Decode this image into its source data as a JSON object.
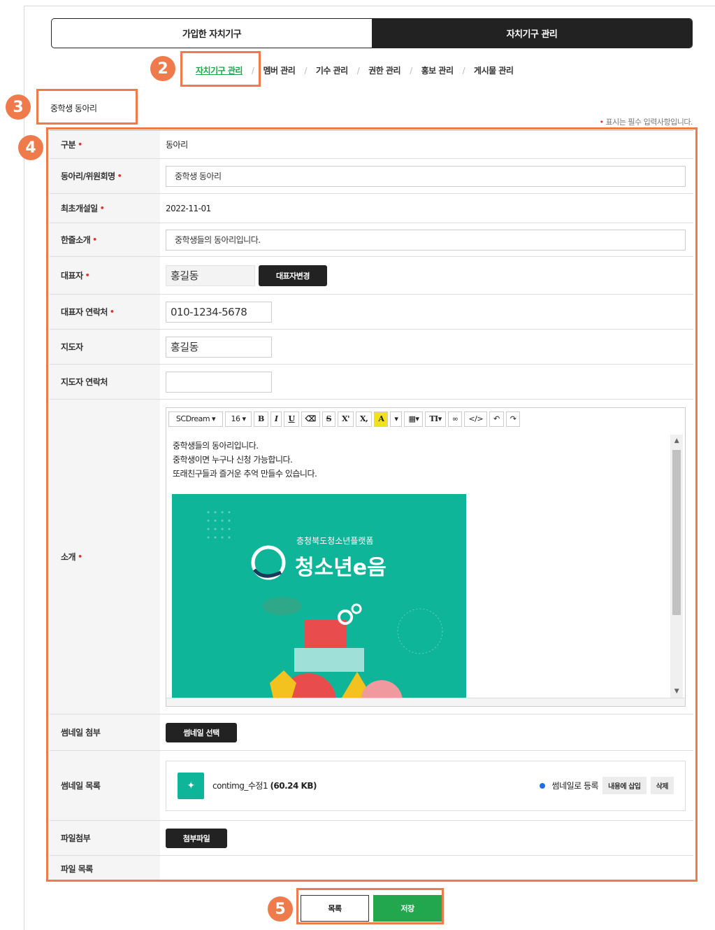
{
  "top_tabs": {
    "joined": "가입한 자치기구",
    "manage": "자치기구 관리"
  },
  "sub_tabs": [
    "자치기구 관리",
    "멤버 관리",
    "기수 관리",
    "권한 관리",
    "홍보 관리",
    "게시물 관리"
  ],
  "org_name": "중학생 동아리",
  "required_note": "표시는 필수 입력사항입니다.",
  "required_mark": "•",
  "fields": {
    "type": {
      "label": "구분",
      "value": "동아리"
    },
    "club_name": {
      "label": "동아리/위원회명",
      "value": "중학생 동아리"
    },
    "founded": {
      "label": "최초개설일",
      "value": "2022-11-01"
    },
    "intro_short": {
      "label": "한줄소개",
      "value": "중학생들의 동아리입니다."
    },
    "rep": {
      "label": "대표자",
      "value": "홍길동",
      "button": "대표자변경"
    },
    "rep_contact": {
      "label": "대표자 연락처",
      "value": "010-1234-5678"
    },
    "advisor": {
      "label": "지도자",
      "value": "홍길동"
    },
    "advisor_contact": {
      "label": "지도자 연락처",
      "value": ""
    },
    "intro": {
      "label": "소개"
    },
    "thumb_attach": {
      "label": "썸네일 첨부",
      "button": "썸네일 선택"
    },
    "thumb_list": {
      "label": "썸네일 목록"
    },
    "file_attach": {
      "label": "파일첨부",
      "button": "첨부파일"
    },
    "file_list": {
      "label": "파일 목록"
    }
  },
  "editor": {
    "font": "SCDream ▾",
    "size": "16 ▾",
    "lines": [
      "중학생들의 동아리입니다.",
      "중학생이면 누구나 신청 가능합니다.",
      "또래친구들과 즐거운 추억 만들수 있습니다."
    ],
    "banner_sub": "충청북도청소년플랫폼",
    "banner_main": "청소년e음"
  },
  "thumbnail": {
    "file_name": "contimg_수정1",
    "file_size": "(60.24 KB)",
    "register_label": "썸네일로 등록",
    "insert_button": "내용에 삽입",
    "delete_button": "삭제"
  },
  "actions": {
    "list": "목록",
    "save": "저장"
  },
  "badges": [
    "2",
    "3",
    "4",
    "5"
  ],
  "colors": {
    "accent_green": "#22a74f",
    "highlight": "#ef7b4d",
    "required": "#e53030",
    "banner": "#0fb598"
  }
}
